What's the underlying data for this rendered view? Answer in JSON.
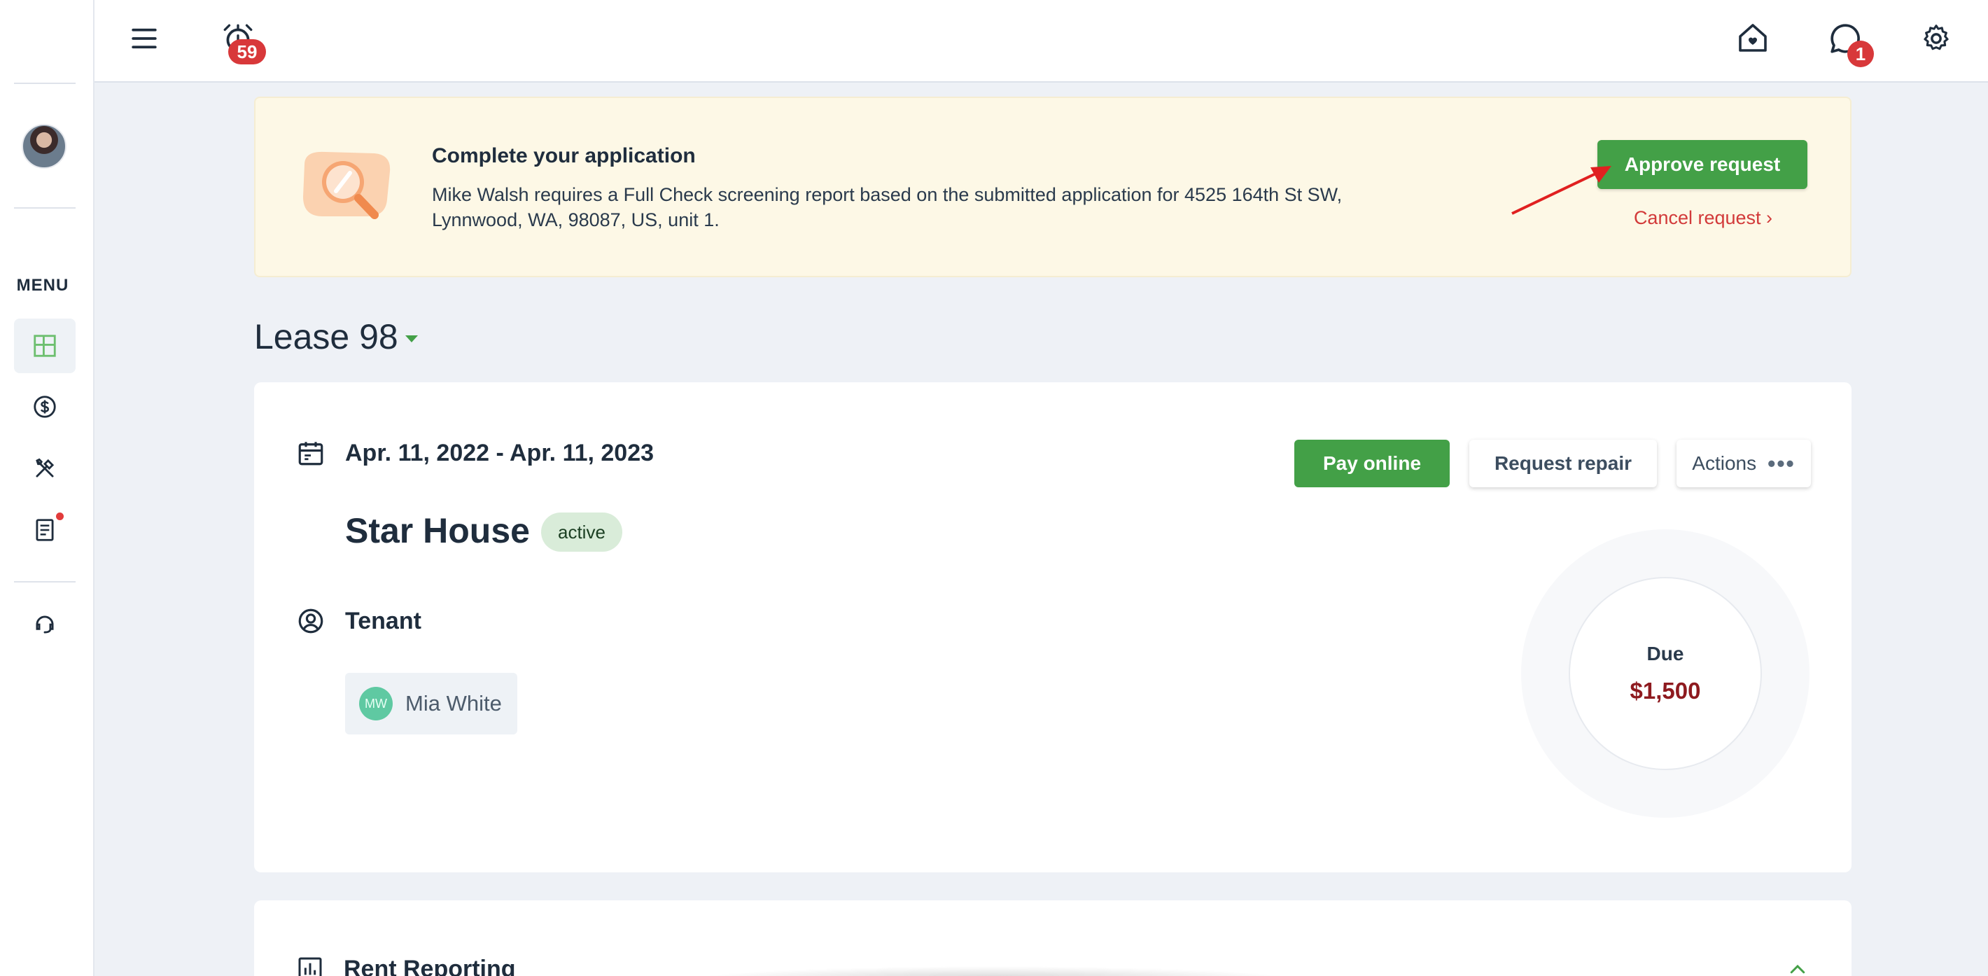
{
  "header": {
    "alarm_badge": "59",
    "messages_badge": "1"
  },
  "sidebar": {
    "menu_label": "MENU",
    "items": [
      {
        "name": "dashboard",
        "icon": "dashboard-icon"
      },
      {
        "name": "payments",
        "icon": "dollar-icon"
      },
      {
        "name": "maintenance",
        "icon": "tools-icon"
      },
      {
        "name": "documents",
        "icon": "document-icon"
      },
      {
        "name": "support",
        "icon": "headset-icon"
      }
    ]
  },
  "banner": {
    "title": "Complete your application",
    "text": "Mike Walsh requires a Full Check screening report based on the submitted application for 4525 164th St SW, Lynnwood, WA, 98087, US, unit 1.",
    "approve_label": "Approve request",
    "cancel_label": "Cancel request ›"
  },
  "lease": {
    "title": "Lease 98",
    "dates": "Apr. 11, 2022 - Apr. 11, 2023",
    "property": "Star House",
    "status": "active",
    "tenant_label": "Tenant",
    "tenant": {
      "initials": "MW",
      "name": "Mia White"
    },
    "pay_label": "Pay online",
    "repair_label": "Request repair",
    "actions_label": "Actions",
    "actions_dots": "•••",
    "due_label": "Due",
    "due_amount": "$1,500"
  },
  "rent_reporting": {
    "title": "Rent Reporting"
  },
  "colors": {
    "accent_green": "#43a047",
    "danger_red": "#d8383a",
    "banner_bg": "#fdf8e6",
    "due_amount": "#8e1a1f"
  }
}
